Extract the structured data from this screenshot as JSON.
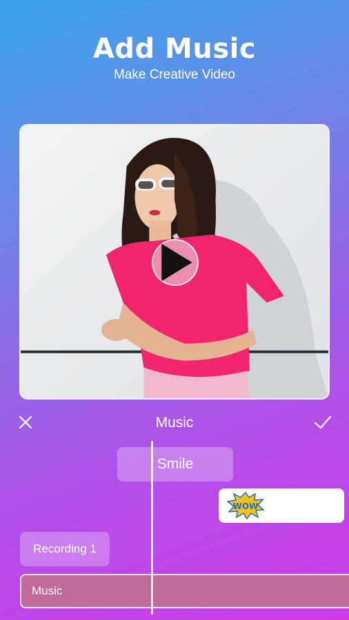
{
  "header": {
    "title": "Add Music",
    "subtitle": "Make Creative Video"
  },
  "preview": {
    "play_icon": "play-icon"
  },
  "editor": {
    "title": "Music",
    "close_icon": "close-icon",
    "confirm_icon": "check-icon"
  },
  "timeline": {
    "text_clip": "Smile",
    "sticker_clip_text": "WOW",
    "recording_clip": "Recording 1",
    "music_clip": "Music"
  },
  "colors": {
    "gradient_top": "#3aa6ea",
    "gradient_bottom": "#cf3ae8",
    "music_track": "#c06a9a",
    "shirt_pink": "#f2246e",
    "wow_sticker": "#f6c216"
  }
}
